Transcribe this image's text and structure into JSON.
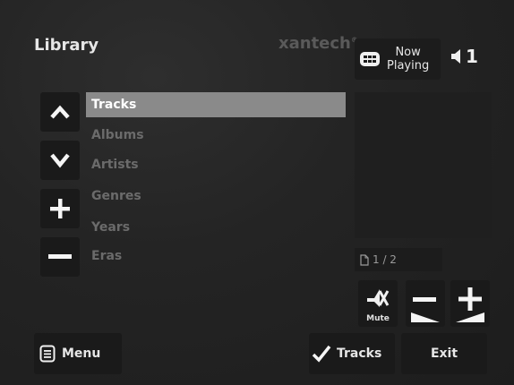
{
  "header": {
    "title": "Library",
    "logo_text": "xantech",
    "logo_mark": "®",
    "now_playing_label_line1": "Now",
    "now_playing_label_line2": "Playing",
    "zone_number": "1"
  },
  "browse": {
    "items": [
      {
        "label": "Tracks",
        "selected": true
      },
      {
        "label": "Albums",
        "selected": false
      },
      {
        "label": "Artists",
        "selected": false
      },
      {
        "label": "Genres",
        "selected": false
      },
      {
        "label": "Years",
        "selected": false
      },
      {
        "label": "Eras",
        "selected": false
      }
    ]
  },
  "paging": {
    "page_text": "1 / 2"
  },
  "controls": {
    "mute_label": "Mute"
  },
  "footer": {
    "menu_label": "Menu",
    "tracks_label": "Tracks",
    "exit_label": "Exit"
  },
  "icons": {
    "up": "chevron-up-icon",
    "down": "chevron-down-icon",
    "plus": "plus-icon",
    "minus": "minus-icon",
    "speaker": "speaker-icon",
    "now_playing": "grid-icon",
    "page": "document-icon",
    "mute": "mute-icon",
    "volume_down": "volume-down-icon",
    "volume_up": "volume-up-icon",
    "menu": "menu-icon",
    "check": "checkmark-icon"
  },
  "colors": {
    "background": "#232323",
    "selected_row": "#8a8a8a",
    "unselected_text": "#6b6b6b",
    "button_bg": "#1a1a1a"
  }
}
